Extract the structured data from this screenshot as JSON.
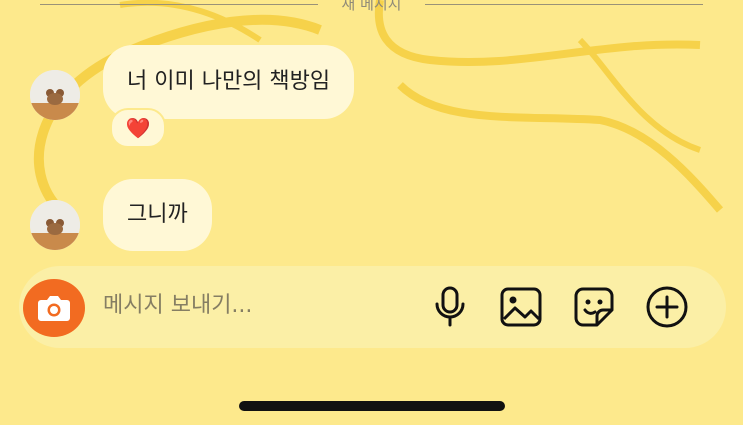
{
  "divider": {
    "label": "새 메시지"
  },
  "messages": [
    {
      "text": "너 이미 나만의 책방임",
      "reaction": "❤️"
    },
    {
      "text": "그니까"
    }
  ],
  "composer": {
    "placeholder": "메시지 보내기..."
  },
  "icons": {
    "camera": "camera-icon",
    "mic": "microphone-icon",
    "gallery": "image-icon",
    "sticker": "sticker-icon",
    "more": "plus-icon"
  },
  "colors": {
    "background": "#fde98c",
    "bubble": "#fff8d6",
    "camera_button": "#f26b21",
    "input_bar": "#fbefa6"
  }
}
